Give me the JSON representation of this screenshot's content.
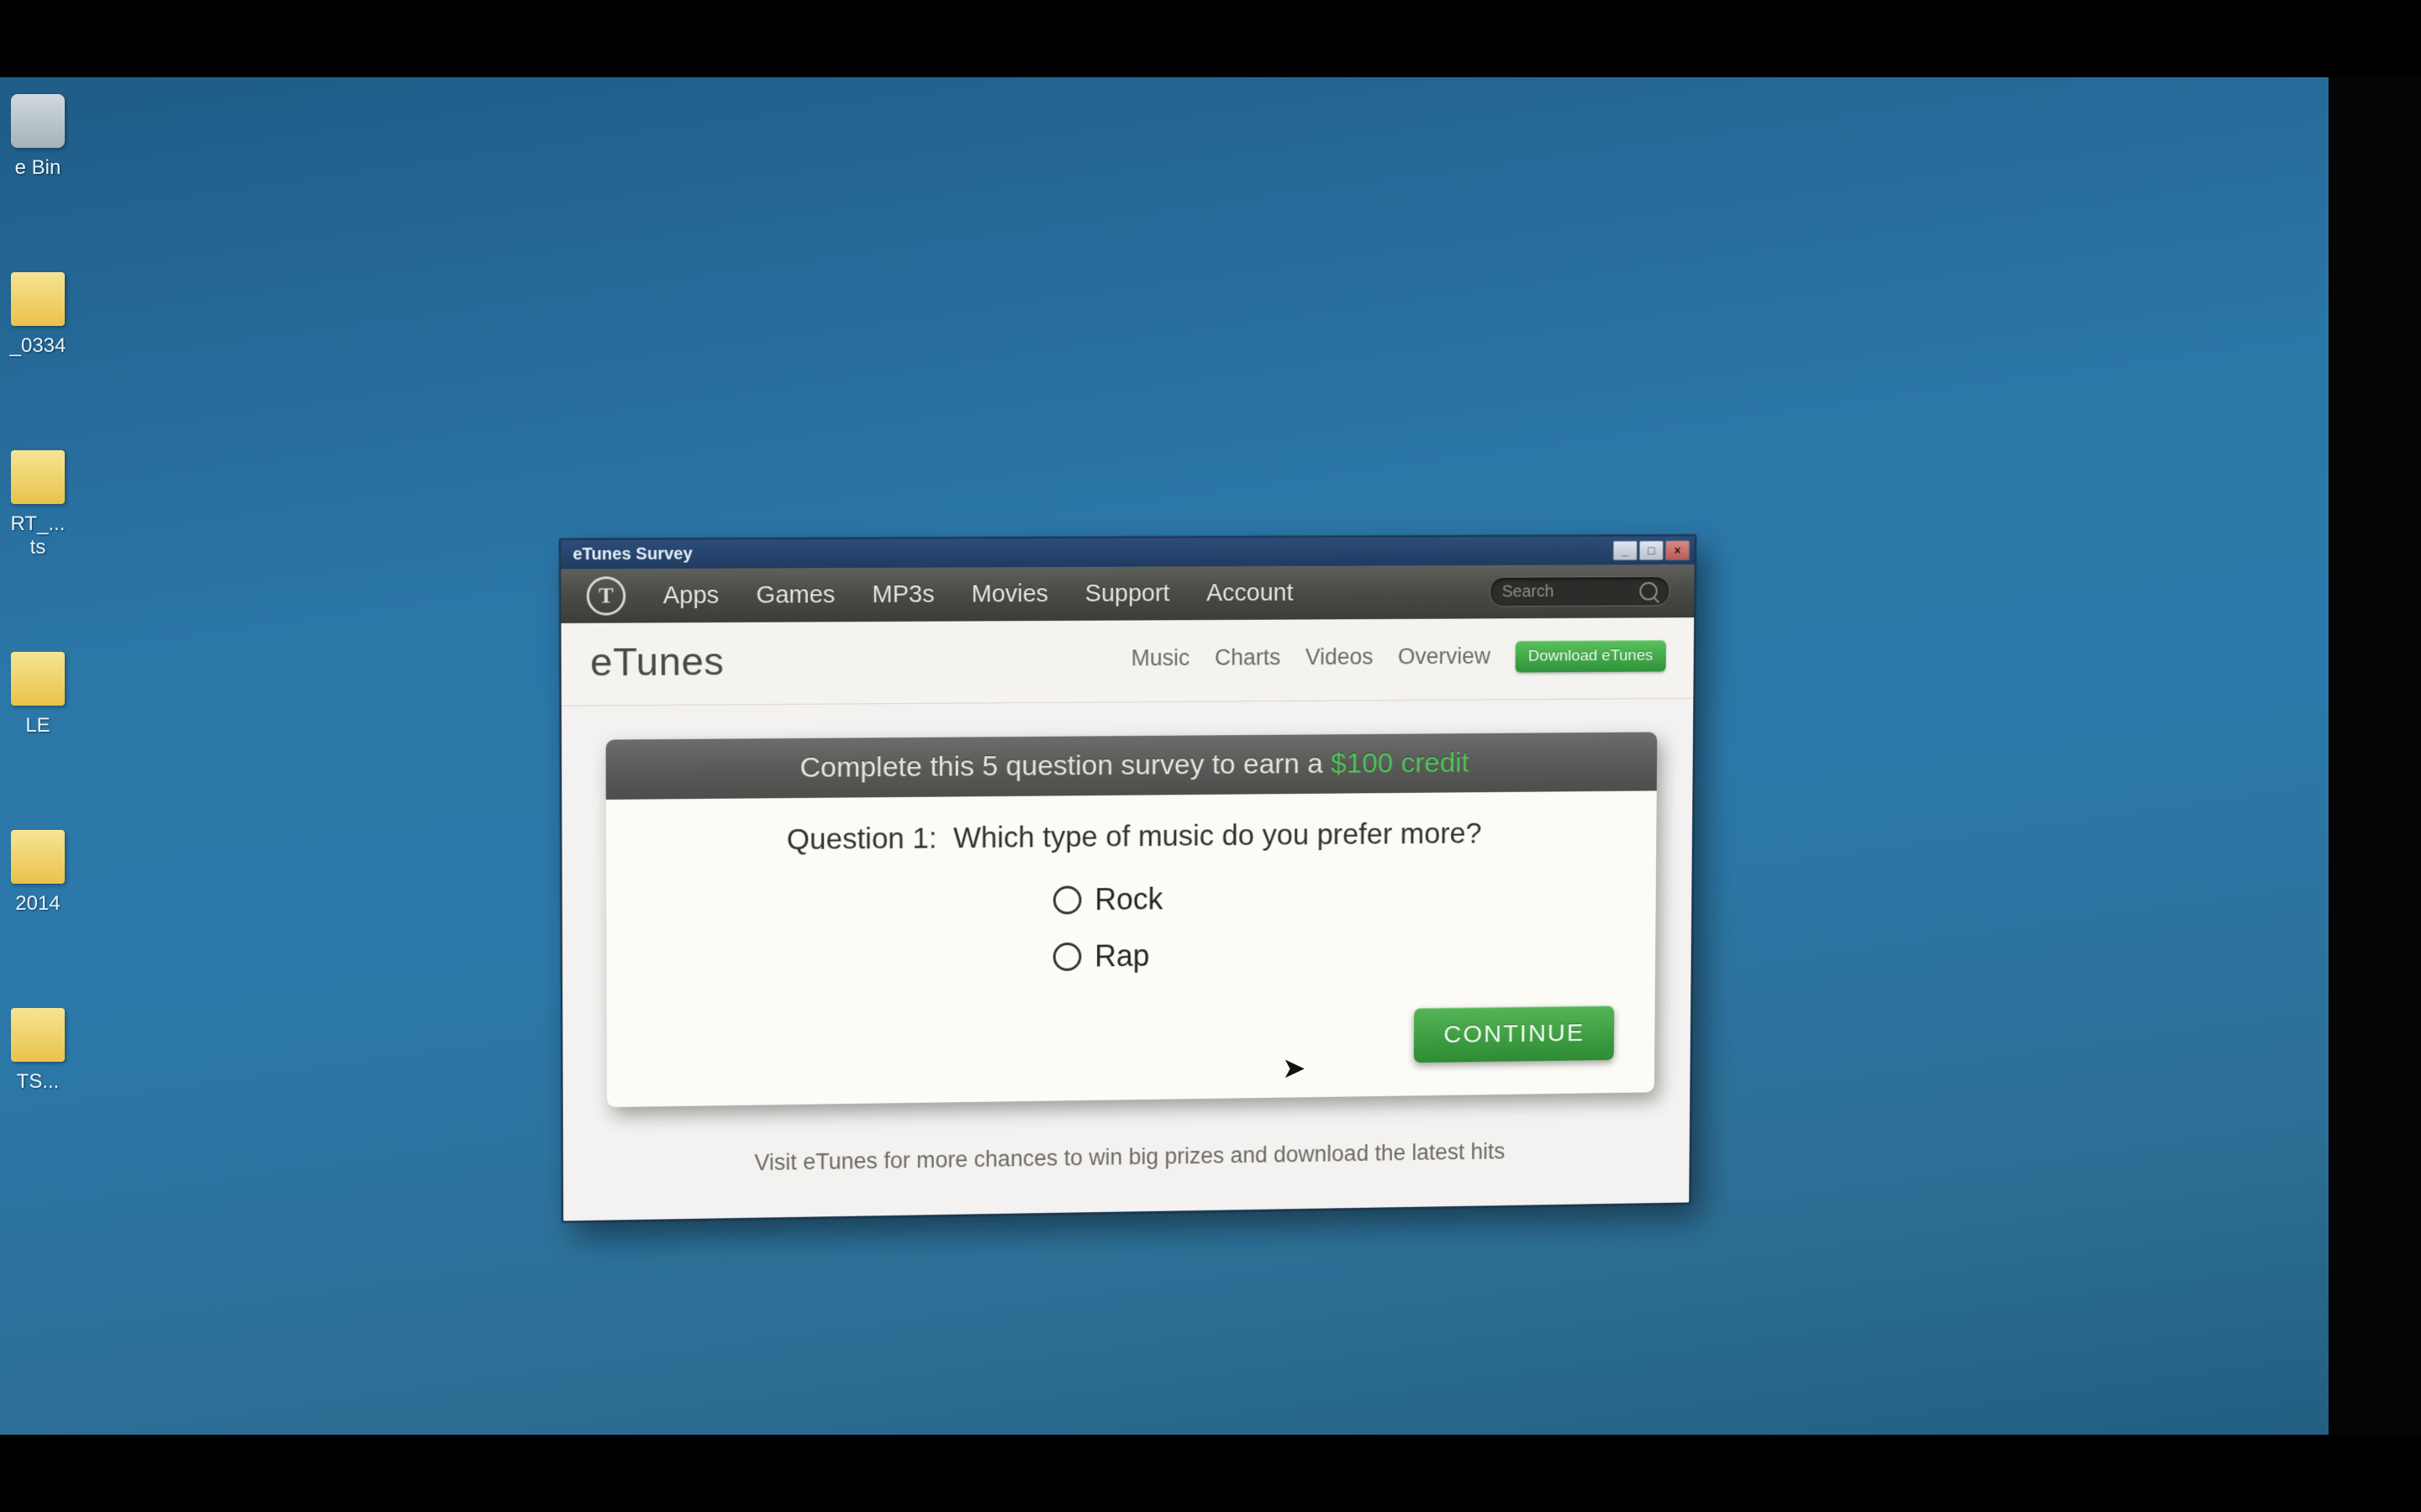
{
  "desktop": {
    "icons": [
      "e Bin",
      "_0334",
      "RT_...\nts",
      "LE",
      "2014",
      "TS..."
    ]
  },
  "window": {
    "title": "eTunes Survey"
  },
  "topnav": {
    "items": [
      "Apps",
      "Games",
      "MP3s",
      "Movies",
      "Support",
      "Account"
    ],
    "search_placeholder": "Search"
  },
  "subnav": {
    "brand": "eTunes",
    "links": [
      "Music",
      "Charts",
      "Videos",
      "Overview"
    ],
    "download_label": "Download eTunes"
  },
  "survey": {
    "banner_prefix": "Complete this  5 question survey to earn a ",
    "banner_credit": "$100 credit",
    "question_label": "Question 1:",
    "question_text": "Which type of music do you prefer more?",
    "options": [
      "Rock",
      "Rap"
    ],
    "continue_label": "CONTINUE"
  },
  "footer": {
    "text": "Visit eTunes for more chances to win big prizes and download the latest hits"
  }
}
